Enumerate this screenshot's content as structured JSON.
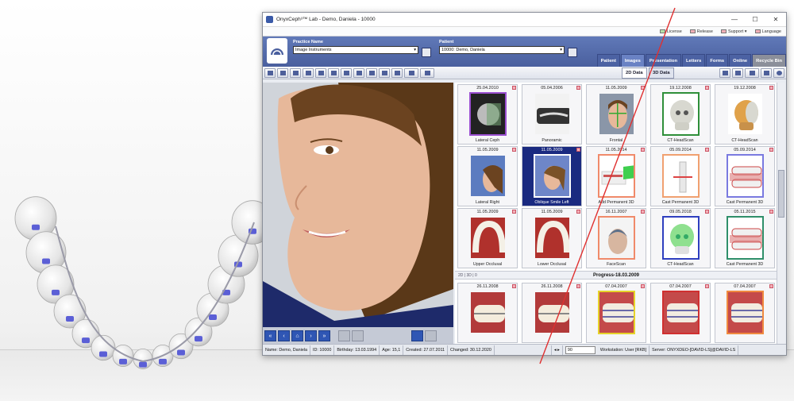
{
  "window": {
    "title": "OnyxCeph³™ Lab - Demo, Daniela - 10000"
  },
  "window_controls": {
    "minimize": "—",
    "maximize": "☐",
    "close": "✕"
  },
  "topmenu": [
    {
      "label": "License"
    },
    {
      "label": "Release"
    },
    {
      "label": "Support ▾"
    },
    {
      "label": "Language"
    }
  ],
  "practice": {
    "label": "Practice Name",
    "value": "Image Instruments"
  },
  "patient": {
    "label": "Patient",
    "value": "10000: Demo, Daniela"
  },
  "tabs": [
    "Patient",
    "Images",
    "Presentation",
    "Letters",
    "Forms",
    "Online",
    "Recycle Bin"
  ],
  "view_tabs": [
    "2D Data",
    "3D Data"
  ],
  "tiles_top": [
    {
      "date": "25.04.2010",
      "caption": "Lateral Ceph",
      "frame": "#9a4fd0",
      "kind": "xray-ceph"
    },
    {
      "date": "05.04.2006",
      "caption": "Panoramic",
      "frame": "",
      "kind": "xray-pan"
    },
    {
      "date": "11.05.2009",
      "caption": "Frontal",
      "frame": "",
      "kind": "face-front"
    },
    {
      "date": "19.12.2008",
      "caption": "CT-HeadScan",
      "frame": "#2f8f3a",
      "kind": "skull"
    },
    {
      "date": "19.12.2008",
      "caption": "CT-HeadScan",
      "frame": "",
      "kind": "skull-orange"
    },
    {
      "date": "11.05.2009",
      "caption": "Lateral Right",
      "frame": "",
      "kind": "face-side"
    },
    {
      "date": "11.05.2009",
      "caption": "Oblique Smile Left",
      "frame": "#ffffff",
      "kind": "face-oblique",
      "selected": true
    },
    {
      "date": "11.05.2014",
      "caption": "Add Permanent 3D",
      "frame": "#f08a6a",
      "kind": "teeth-green"
    },
    {
      "date": "05.09.2014",
      "caption": "Cast Permanent 3D",
      "frame": "#f0a070",
      "kind": "tooth-single"
    },
    {
      "date": "05.09.2014",
      "caption": "Cast Permanent 3D",
      "frame": "#7a7ae0",
      "kind": "teeth-open"
    },
    {
      "date": "11.05.2009",
      "caption": "Upper Occlusal",
      "frame": "",
      "kind": "occlusal"
    },
    {
      "date": "11.05.2009",
      "caption": "Lower Occlusal",
      "frame": "",
      "kind": "occlusal"
    },
    {
      "date": "16.11.2007",
      "caption": "FaceScan",
      "frame": "#f08a6a",
      "kind": "facescan"
    },
    {
      "date": "09.05.2018",
      "caption": "CT-HeadScan",
      "frame": "#2f3fbf",
      "kind": "skull-green"
    },
    {
      "date": "05.11.2015",
      "caption": "Cast Permanent 3D",
      "frame": "#2f8f6a",
      "kind": "teeth-open"
    }
  ],
  "progress_label": "Progress-18.03.2009",
  "progress_index": "2D | 3D | 0",
  "tiles_bottom": [
    {
      "date": "26.11.2008",
      "caption": "",
      "frame": "",
      "kind": "smile"
    },
    {
      "date": "26.11.2008",
      "caption": "",
      "frame": "",
      "kind": "smile"
    },
    {
      "date": "07.04.2007",
      "caption": "",
      "frame": "#e6d32a",
      "kind": "braces"
    },
    {
      "date": "07.04.2007",
      "caption": "",
      "frame": "#d03030",
      "kind": "braces"
    },
    {
      "date": "07.04.2007",
      "caption": "",
      "frame": "#f08a40",
      "kind": "braces"
    }
  ],
  "status": {
    "name": "Name: Demo, Daniela",
    "id": "ID: 10000",
    "birthday": "Birthday: 13.03.1994",
    "age": "Age: 15,1",
    "created": "Created: 27.07.2011",
    "changed": "Changed: 30.12.2020",
    "zoom": "90",
    "workstation": "Workstation: User [RKB]",
    "server": "Server: ONYXDEO-[DAVID-LS]@DAVID-LS"
  },
  "colors": {
    "header_blue": "#5269a8",
    "accent_blue": "#2f56b4",
    "bracket_blue": "#5b5fd6"
  },
  "icons": {
    "logo": "onyxceph-logo-icon",
    "nav": [
      "first-icon",
      "prev-icon",
      "home-icon",
      "play-icon",
      "last-icon"
    ]
  }
}
